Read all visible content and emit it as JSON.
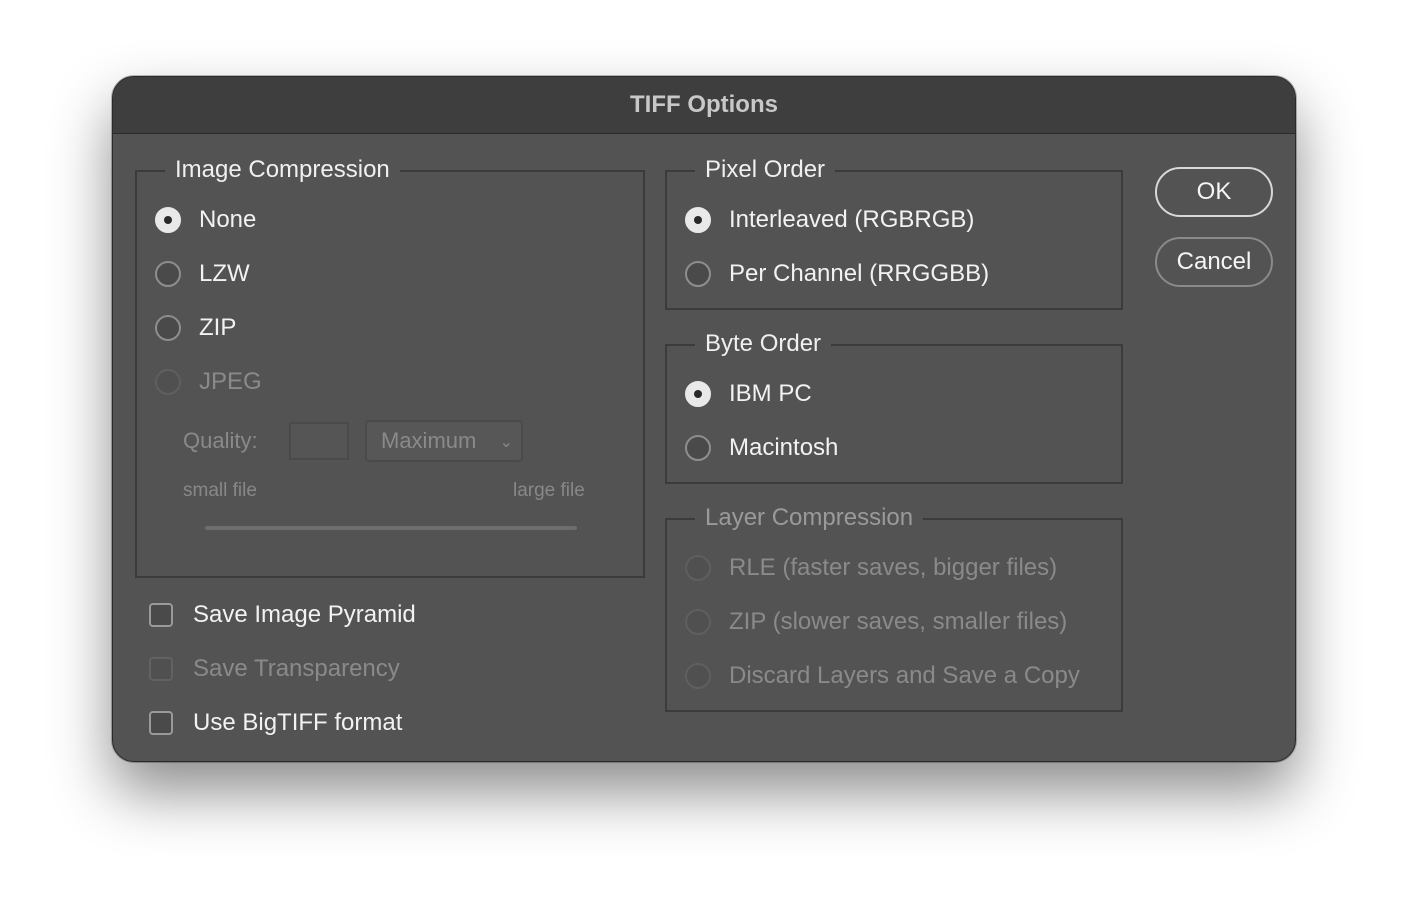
{
  "dialog": {
    "title": "TIFF Options"
  },
  "buttons": {
    "ok": "OK",
    "cancel": "Cancel"
  },
  "image_compression": {
    "legend": "Image Compression",
    "options": [
      {
        "label": "None",
        "checked": true,
        "disabled": false
      },
      {
        "label": "LZW",
        "checked": false,
        "disabled": false
      },
      {
        "label": "ZIP",
        "checked": false,
        "disabled": false
      },
      {
        "label": "JPEG",
        "checked": false,
        "disabled": true
      }
    ],
    "quality_label": "Quality:",
    "quality_value": "",
    "quality_preset": "Maximum",
    "small_file": "small file",
    "large_file": "large file"
  },
  "pixel_order": {
    "legend": "Pixel Order",
    "options": [
      {
        "label": "Interleaved (RGBRGB)",
        "checked": true
      },
      {
        "label": "Per Channel (RRGGBB)",
        "checked": false
      }
    ]
  },
  "byte_order": {
    "legend": "Byte Order",
    "options": [
      {
        "label": "IBM PC",
        "checked": true
      },
      {
        "label": "Macintosh",
        "checked": false
      }
    ]
  },
  "layer_compression": {
    "legend": "Layer Compression",
    "options": [
      {
        "label": "RLE (faster saves, bigger files)",
        "disabled": true
      },
      {
        "label": "ZIP (slower saves, smaller files)",
        "disabled": true
      },
      {
        "label": "Discard Layers and Save a Copy",
        "disabled": true
      }
    ]
  },
  "checkboxes": [
    {
      "label": "Save Image Pyramid",
      "checked": false,
      "disabled": false
    },
    {
      "label": "Save Transparency",
      "checked": false,
      "disabled": true
    },
    {
      "label": "Use BigTIFF format",
      "checked": false,
      "disabled": false
    }
  ]
}
